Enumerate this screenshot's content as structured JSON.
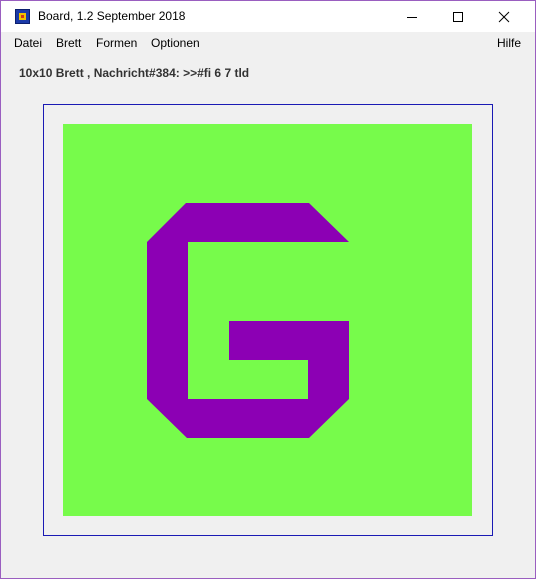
{
  "window": {
    "title": "Board, 1.2 September 2018",
    "icon": "app-board-icon",
    "controls": [
      "minimize-icon",
      "maximize-icon",
      "close-icon"
    ]
  },
  "menubar": {
    "datei": "Datei",
    "brett": "Brett",
    "formen": "Formen",
    "optionen": "Optionen",
    "hilfe": "Hilfe"
  },
  "status": {
    "text": "10x10 Brett , Nachricht#384: >>#fi 6 7 tld"
  },
  "board": {
    "size": "10x10",
    "background_color": "#77fb4b",
    "shape_color": "#8c00b4",
    "frame_color": "#1a1ab4",
    "shape": "letter-G"
  }
}
